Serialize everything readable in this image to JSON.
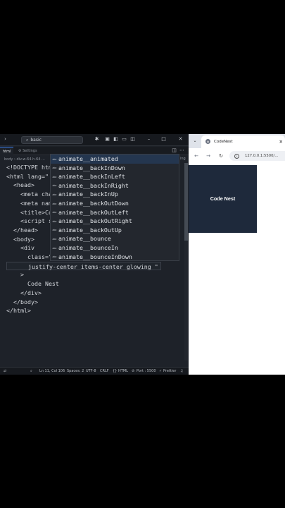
{
  "editor": {
    "search": "basic",
    "tabs": {
      "active": "html",
      "other": "Settings"
    },
    "breadcrumb": "body  ›  div.w-64.h-64 ...",
    "code_lines": [
      "<!DOCTYPE htm",
      "<html lang=\"",
      "  <head>",
      "    <meta cha",
      "    <meta nam",
      "    <title>Co",
      "    <script s",
      "  </head>",
      "  <body>",
      "    <div",
      "      class=\"",
      "      justify-center items-center glowing \"",
      "    >",
      "      Code Nest",
      "    </div>",
      "  </body>",
      "</html>"
    ],
    "suggestions": [
      "animate__animated",
      "animate__backInDown",
      "animate__backInLeft",
      "animate__backInRight",
      "animate__backInUp",
      "animate__backOutDown",
      "animate__backOutLeft",
      "animate__backOutRight",
      "animate__backOutUp",
      "animate__bounce",
      "animate__bounceIn",
      "animate__bounceInDown"
    ],
    "suggestion_kind": "abc",
    "side_hint": "ing",
    "status": {
      "position": "Ln 11, Col 106",
      "spaces": "Spaces: 2",
      "encoding": "UTF-8",
      "eol": "CRLF",
      "language": "HTML",
      "port": "Port : 5500",
      "formatter": "Prettier"
    }
  },
  "browser": {
    "tab_title": "CodeNest",
    "url": "127.0.0.1:5500/...",
    "page_heading": "Code Nest"
  },
  "colors": {
    "editor_bg": "#1e2229",
    "hero_bg": "#1e293b",
    "selection": "#24364f"
  }
}
